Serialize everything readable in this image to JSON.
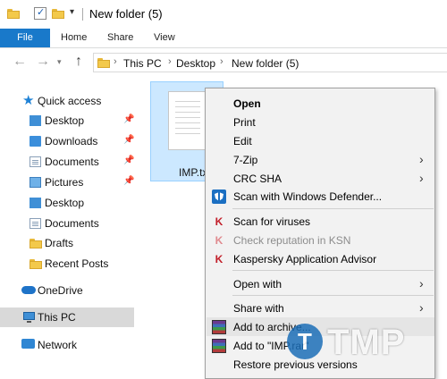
{
  "window": {
    "title": "New folder (5)"
  },
  "ribbon": {
    "tabs": [
      "File",
      "Home",
      "Share",
      "View"
    ]
  },
  "address": {
    "crumbs": [
      "This PC",
      "Desktop",
      "New folder (5)"
    ]
  },
  "nav": {
    "quick_access": "Quick access",
    "items": [
      {
        "label": "Desktop",
        "pinned": true
      },
      {
        "label": "Downloads",
        "pinned": true
      },
      {
        "label": "Documents",
        "pinned": true
      },
      {
        "label": "Pictures",
        "pinned": true
      },
      {
        "label": "Desktop",
        "pinned": false
      },
      {
        "label": "Documents",
        "pinned": false
      },
      {
        "label": "Drafts",
        "pinned": false
      },
      {
        "label": "Recent Posts",
        "pinned": false
      }
    ],
    "onedrive": "OneDrive",
    "this_pc": "This PC",
    "network": "Network"
  },
  "file": {
    "name": "IMP.tx"
  },
  "context_menu": {
    "open": "Open",
    "print": "Print",
    "edit": "Edit",
    "seven_zip": "7-Zip",
    "crc_sha": "CRC SHA",
    "defender": "Scan with Windows Defender...",
    "scan_viruses": "Scan for viruses",
    "check_reputation": "Check reputation in KSN",
    "kaspersky_advisor": "Kaspersky Application Advisor",
    "open_with": "Open with",
    "share_with": "Share with",
    "add_archive": "Add to archive...",
    "add_rar": "Add to \"IMP.rar\"",
    "restore": "Restore previous versions"
  },
  "watermark": {
    "letter": "T",
    "text": "TMP"
  }
}
